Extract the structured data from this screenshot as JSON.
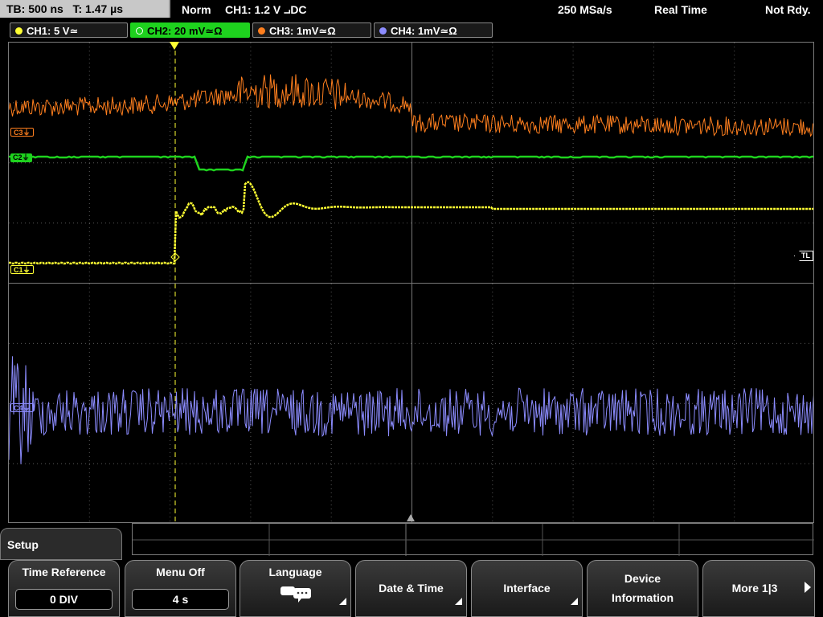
{
  "topbar": {
    "timebase": "TB: 500 ns",
    "trigger_time": "T: 1.47 µs",
    "mode": "Norm",
    "trigger": "CH1: 1.2 V ⨼DC",
    "sample_rate": "250 MSa/s",
    "acq_mode": "Real Time",
    "status": "Not Rdy."
  },
  "channels": [
    {
      "label": "CH1: 5 V≃",
      "color": "#ffff33",
      "active": false
    },
    {
      "label": "CH2: 20 mV≃Ω",
      "color": "#1ed21e",
      "active": true
    },
    {
      "label": "CH3: 1mV≃Ω",
      "color": "#ff7f1e",
      "active": false
    },
    {
      "label": "CH4: 1mV≃Ω",
      "color": "#8c8cff",
      "active": false
    }
  ],
  "markers": {
    "c3": "C3⏚",
    "c2": "C2⏚",
    "c1": "C1⏚",
    "c4": "C4⏚",
    "tl": "TL"
  },
  "menu": {
    "title": "Setup",
    "softkeys": [
      {
        "label": "Time Reference",
        "value": "0 DIV"
      },
      {
        "label": "Menu Off",
        "value": "4 s"
      },
      {
        "label": "Language",
        "icon": "speech-bubbles-icon"
      },
      {
        "label": "Date & Time"
      },
      {
        "label": "Interface"
      },
      {
        "label_line1": "Device",
        "label_line2": "Information"
      },
      {
        "label": "More 1|3"
      }
    ]
  },
  "colors": {
    "ch1": "#ffff33",
    "ch2": "#1ed21e",
    "ch3": "#ff7f1e",
    "ch4": "#8c8cff",
    "grid": "#5a5a5a"
  }
}
